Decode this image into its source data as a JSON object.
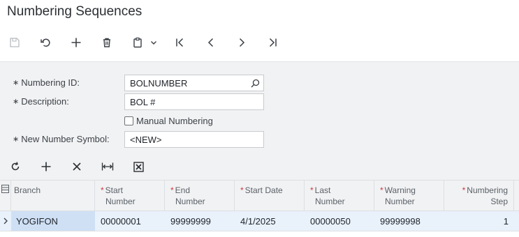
{
  "page": {
    "title": "Numbering Sequences"
  },
  "toolbar": {
    "items": [
      {
        "icon": "save-icon",
        "enabled": false
      },
      {
        "icon": "undo-icon",
        "enabled": true
      },
      {
        "icon": "add-icon",
        "enabled": true
      },
      {
        "icon": "delete-icon",
        "enabled": true
      },
      {
        "icon": "clipboard-icon",
        "enabled": true
      },
      {
        "icon": "chevron-down-icon",
        "enabled": true
      },
      {
        "icon": "first-record-icon",
        "enabled": true
      },
      {
        "icon": "previous-record-icon",
        "enabled": true
      },
      {
        "icon": "next-record-icon",
        "enabled": true
      },
      {
        "icon": "last-record-icon",
        "enabled": true
      }
    ]
  },
  "form": {
    "numbering_id": {
      "label": "Numbering ID:",
      "value": "BOLNUMBER",
      "required": true
    },
    "description": {
      "label": "Description:",
      "value": "BOL #",
      "required": true
    },
    "manual_numbering": {
      "label": "Manual Numbering",
      "checked": false
    },
    "new_number_symbol": {
      "label": "New Number Symbol:",
      "value": "<NEW>",
      "required": true
    }
  },
  "grid_toolbar": {
    "items": [
      "refresh-icon",
      "add-row-icon",
      "delete-row-icon",
      "fit-columns-icon",
      "export-excel-icon"
    ]
  },
  "grid": {
    "columns": [
      {
        "line1": "Branch",
        "line2": "",
        "required": false
      },
      {
        "line1": "Start",
        "line2": "Number",
        "required": true
      },
      {
        "line1": "End",
        "line2": "Number",
        "required": true
      },
      {
        "line1": "Start Date",
        "line2": "",
        "required": true
      },
      {
        "line1": "Last",
        "line2": "Number",
        "required": true
      },
      {
        "line1": "Warning",
        "line2": "Number",
        "required": true
      },
      {
        "line1": "Numbering",
        "line2": "Step",
        "required": true
      }
    ],
    "rows": [
      {
        "branch": "YOGIFON",
        "start_number": "00000001",
        "end_number": "99999999",
        "start_date": "4/1/2025",
        "last_number": "00000050",
        "warning_number": "99999998",
        "numbering_step": "1"
      }
    ]
  },
  "colors": {
    "required": "#d0343f",
    "selected_row": "#e9f1fb",
    "selected_cell": "#cfe0f5",
    "form_bg": "#f1f2f3"
  }
}
